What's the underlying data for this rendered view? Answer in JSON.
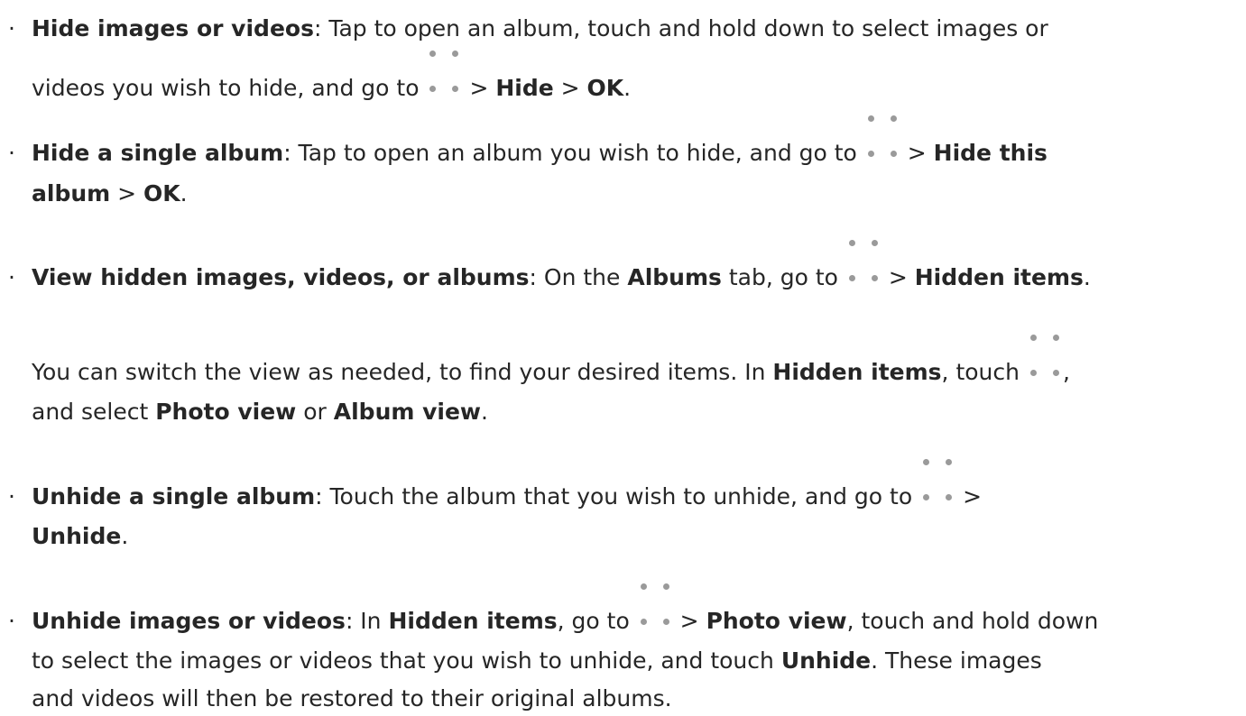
{
  "bullet_char": "·",
  "icons": {
    "more": "more-options-icon"
  },
  "colors": {
    "text": "#262626",
    "icon_dots": "#9a9a9a"
  },
  "items": [
    {
      "title": "Hide images or videos",
      "l1": ": Tap to open an album, touch and hold down to select images or",
      "l2a": "videos you wish to hide, and go to",
      "sep": ">",
      "b1": "Hide",
      "b2": "OK",
      "end": "."
    },
    {
      "title": "Hide a single album",
      "l1": ": Tap to open an album you wish to hide, and go to",
      "sep": ">",
      "b1a": "Hide this",
      "b1b": "album",
      "b2": "OK",
      "end": "."
    },
    {
      "title": "View hidden images, videos, or albums",
      "l1": ": On the",
      "b_albums": "Albums",
      "l1b": "tab, go to",
      "sep": ">",
      "b1": "Hidden items",
      "end": ".",
      "p2a": "You can switch the view as needed, to find your desired items. In",
      "p2b": "Hidden items",
      "p2c": ", touch",
      "p2d": ",",
      "p3a": "and select",
      "p3b": "Photo view",
      "p3c": "or",
      "p3d": "Album view",
      "p3e": "."
    },
    {
      "title": "Unhide a single album",
      "l1": ": Touch the album that you wish to unhide, and go to",
      "sep": ">",
      "b1": "Unhide",
      "end": "."
    },
    {
      "title": "Unhide images or videos",
      "l1a": ": In",
      "b_hidden": "Hidden items",
      "l1b": ", go to",
      "sep": ">",
      "b_photo": "Photo view",
      "l1c": ", touch and hold down",
      "l2a": "to select the images or videos that you wish to unhide, and touch",
      "b_unhide": "Unhide",
      "l2b": ". These images",
      "l3": "and videos will then be restored to their original albums."
    }
  ]
}
